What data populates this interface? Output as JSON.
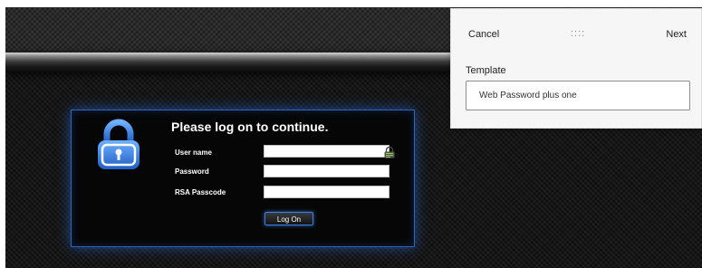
{
  "login": {
    "title": "Please log on to continue.",
    "fields": [
      {
        "label": "User name",
        "value": ""
      },
      {
        "label": "Password",
        "value": ""
      },
      {
        "label": "RSA Passcode",
        "value": ""
      }
    ],
    "submit_label": "Log On",
    "lock_icon": "padlock-icon",
    "keypass_icon": "password-manager-icon",
    "accent_color": "#3d7fe0"
  },
  "popover": {
    "cancel_label": "Cancel",
    "drag_handle": "::::",
    "next_label": "Next",
    "template_label": "Template",
    "template_value": "Web Password plus one"
  }
}
